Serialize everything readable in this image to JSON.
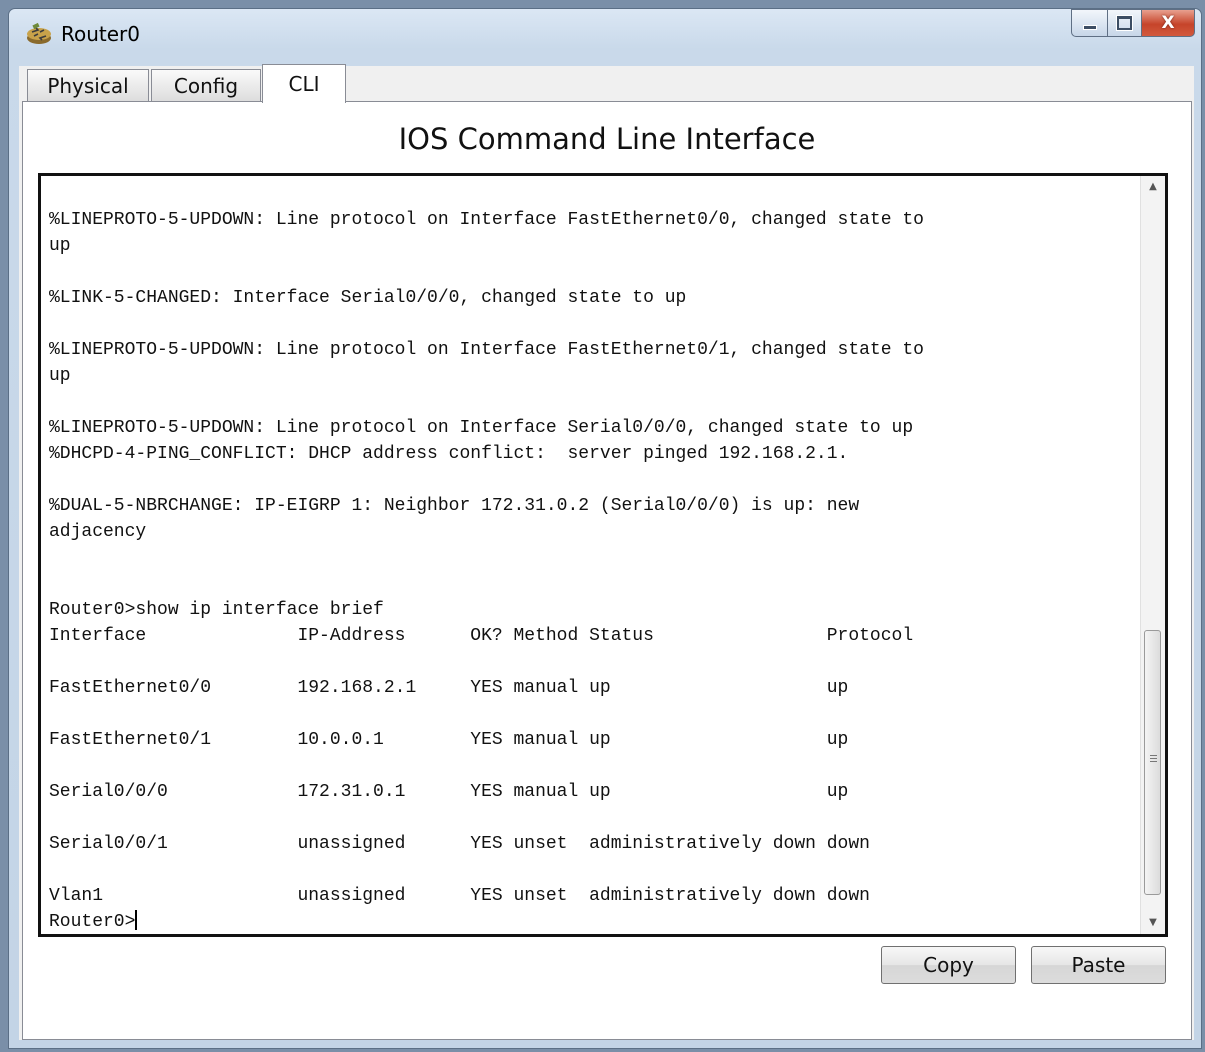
{
  "window": {
    "title": "Router0",
    "app_icon": "router-icon",
    "controls": {
      "minimize_icon": "minimize-icon",
      "maximize_icon": "maximize-icon",
      "close_icon": "close-icon",
      "close_glyph": "X"
    }
  },
  "tabs": [
    {
      "label": "Physical",
      "active": false
    },
    {
      "label": "Config",
      "active": false
    },
    {
      "label": "CLI",
      "active": true
    }
  ],
  "cli": {
    "heading": "IOS Command Line Interface",
    "lines": [
      "",
      "%LINEPROTO-5-UPDOWN: Line protocol on Interface FastEthernet0/0, changed state to",
      "up",
      "",
      "%LINK-5-CHANGED: Interface Serial0/0/0, changed state to up",
      "",
      "%LINEPROTO-5-UPDOWN: Line protocol on Interface FastEthernet0/1, changed state to",
      "up",
      "",
      "%LINEPROTO-5-UPDOWN: Line protocol on Interface Serial0/0/0, changed state to up",
      "%DHCPD-4-PING_CONFLICT: DHCP address conflict:  server pinged 192.168.2.1.",
      "",
      "%DUAL-5-NBRCHANGE: IP-EIGRP 1: Neighbor 172.31.0.2 (Serial0/0/0) is up: new",
      "adjacency",
      "",
      "",
      "Router0>show ip interface brief",
      "Interface              IP-Address      OK? Method Status                Protocol",
      "",
      "FastEthernet0/0        192.168.2.1     YES manual up                    up",
      "",
      "FastEthernet0/1        10.0.0.1        YES manual up                    up",
      "",
      "Serial0/0/0            172.31.0.1      YES manual up                    up",
      "",
      "Serial0/0/1            unassigned      YES unset  administratively down down",
      "",
      "Vlan1                  unassigned      YES unset  administratively down down"
    ],
    "prompt": "Router0>",
    "scroll_up_icon": "scroll-up-arrow-icon",
    "scroll_down_icon": "scroll-down-arrow-icon"
  },
  "buttons": {
    "copy": "Copy",
    "paste": "Paste"
  },
  "colors": {
    "close_button": "#c6442a",
    "console_border": "#111111"
  }
}
